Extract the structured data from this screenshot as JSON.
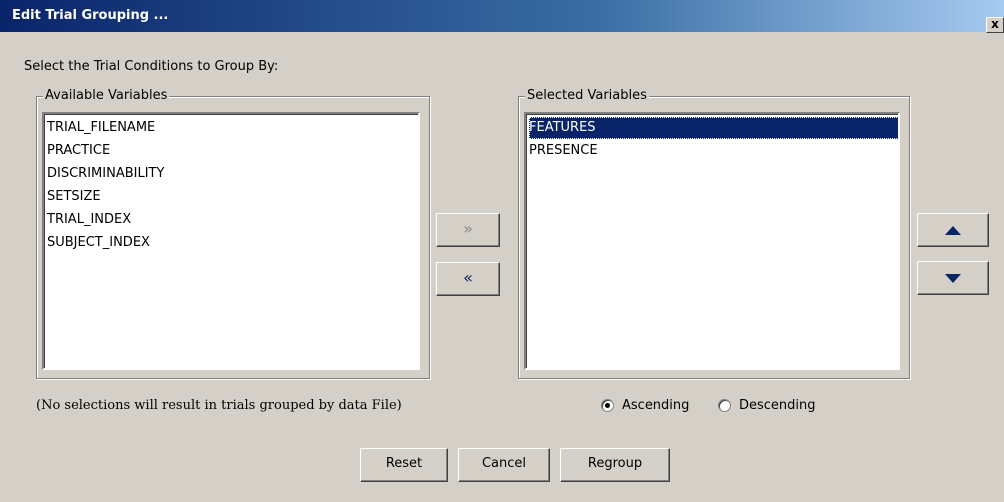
{
  "window": {
    "title": "Edit Trial Grouping ...",
    "close_label": "x"
  },
  "instruction": "Select the Trial Conditions to Group By:",
  "available": {
    "legend": "Available Variables",
    "items": [
      "TRIAL_FILENAME",
      "PRACTICE",
      "DISCRIMINABILITY",
      "SETSIZE",
      "TRIAL_INDEX",
      "SUBJECT_INDEX"
    ]
  },
  "selected": {
    "legend": "Selected Variables",
    "items": [
      "FEATURES",
      "PRESENCE"
    ],
    "selected_item": "FEATURES"
  },
  "transfer": {
    "add_label": "»",
    "remove_label": "«"
  },
  "order": {
    "up_icon": "triangle-up-icon",
    "down_icon": "triangle-down-icon"
  },
  "note": "(No selections will result in trials grouped by data File)",
  "sort": {
    "ascending_label": "Ascending",
    "descending_label": "Descending",
    "selected": "Ascending"
  },
  "buttons": {
    "reset": "Reset",
    "cancel": "Cancel",
    "regroup": "Regroup"
  },
  "colors": {
    "title_bar_start": "#0a246a",
    "selection": "#0a246a",
    "dialog_bg": "#d4d0c8"
  }
}
